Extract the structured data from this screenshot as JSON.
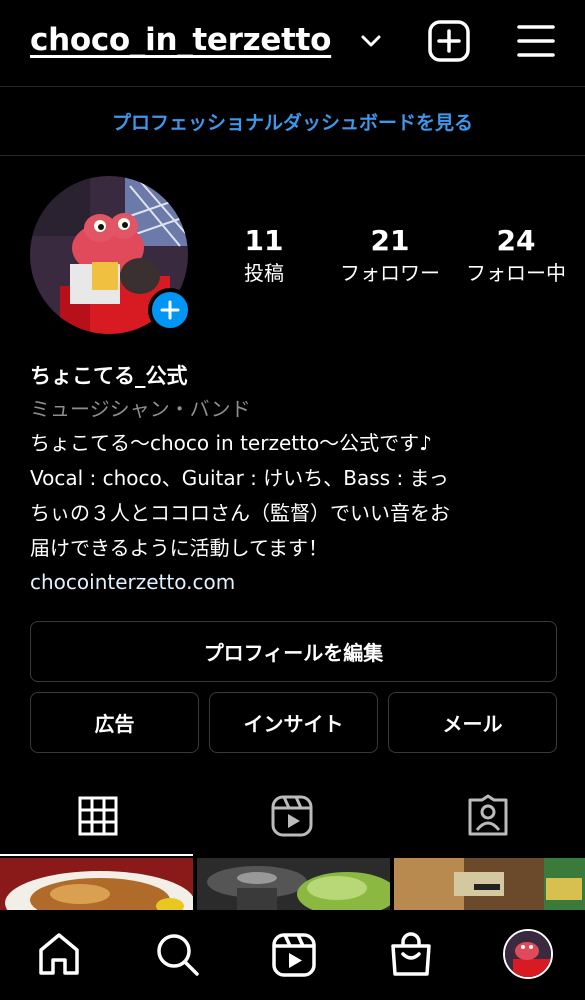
{
  "header": {
    "username": "choco_in_terzetto",
    "dashboard_link": "プロフェッショナルダッシュボードを見る"
  },
  "stats": [
    {
      "value": "11",
      "label": "投稿"
    },
    {
      "value": "21",
      "label": "フォロワー"
    },
    {
      "value": "24",
      "label": "フォロー中"
    }
  ],
  "bio": {
    "name": "ちょこてる_公式",
    "category": "ミュージシャン・バンド",
    "text": "ちょこてる〜choco in terzetto〜公式です♪\nVocal : choco、Guitar : けいち、Bass : まっ\nちぃの３人とココロさん（監督）でいい音をお\n届けできるように活動してます！",
    "link": "chocointerzetto.com"
  },
  "buttons": {
    "edit_profile": "プロフィールを編集",
    "ads": "広告",
    "insights": "インサイト",
    "mail": "メール"
  },
  "tabs": [
    {
      "icon": "grid-icon",
      "active": true
    },
    {
      "icon": "reels-icon",
      "active": false
    },
    {
      "icon": "tagged-icon",
      "active": false
    }
  ],
  "bottom_nav": [
    {
      "icon": "home-icon"
    },
    {
      "icon": "search-icon"
    },
    {
      "icon": "reels-icon"
    },
    {
      "icon": "shop-icon"
    },
    {
      "icon": "profile-avatar"
    }
  ],
  "colors": {
    "background": "#000000",
    "link_blue": "#3d97ea",
    "accent_blue": "#0095f6",
    "border": "#3a3a3a"
  }
}
